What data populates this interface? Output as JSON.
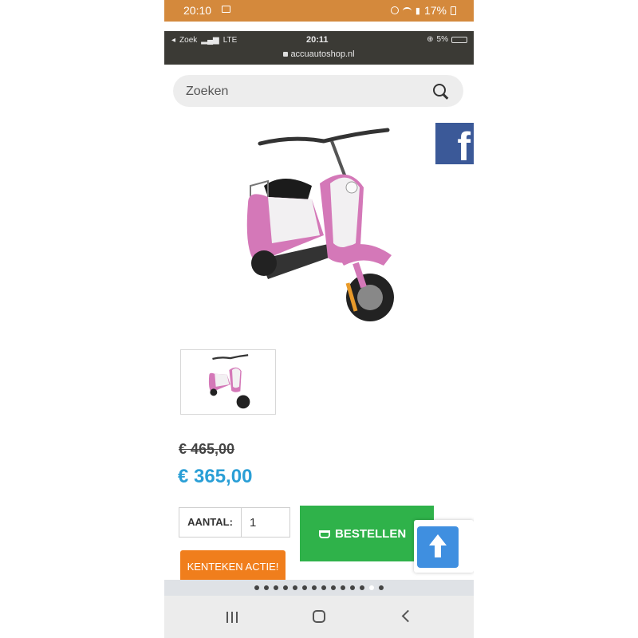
{
  "device_status": {
    "time": "20:10",
    "battery": "17%"
  },
  "browser_status": {
    "back_app": "Zoek",
    "network": "LTE",
    "time": "20:11",
    "battery": "5%",
    "url": "accuautoshop.nl"
  },
  "search": {
    "placeholder": "Zoeken"
  },
  "social": {
    "facebook_letter": "f"
  },
  "product": {
    "old_price": "€ 465,00",
    "price": "€ 365,00",
    "colors": {
      "body": "#d478b8",
      "panel": "#f2f0f2",
      "price": "#2a9fd6"
    }
  },
  "order": {
    "quantity_label": "AANTAL:",
    "quantity_value": "1",
    "order_button": "BESTELLEN",
    "order_color": "#2fb24a"
  },
  "promo": {
    "label": "KENTEKEN ACTIE!",
    "color": "#f07e1c"
  },
  "pagination": {
    "total": 14,
    "active_index": 12
  }
}
